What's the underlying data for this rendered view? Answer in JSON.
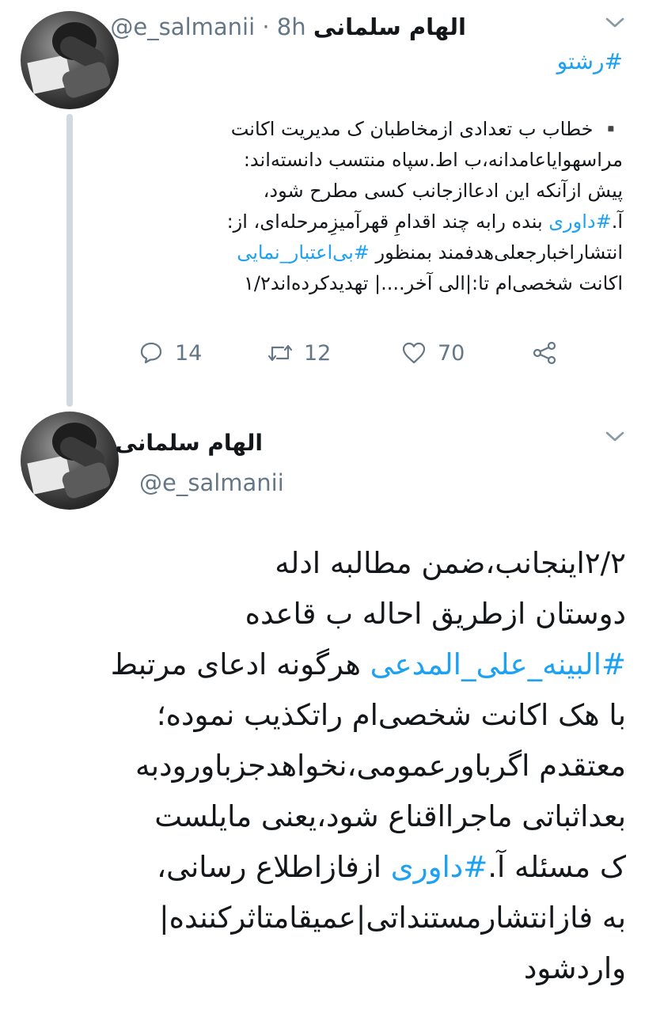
{
  "tweet1": {
    "author_name": "الهام سلمانی",
    "handle": "@e_salmanii",
    "separator": "·",
    "time": "8h",
    "thread_tag": "#رشتو",
    "lines": [
      "▪️ خطاب ب تعدادی ازمخاطبان ک مدیریت اکانت",
      "مراسهوایاعامدانه،ب اط.سپاه منتسب دانسته‌اند:",
      "پیش ازآنکه این ادعاازجانب کسی مطرح شود،"
    ],
    "line4_pre": "آ.",
    "line4_tag": "#داوری",
    "line4_post": " بنده رابه چند اقدامِ قهرآمیزِمرحله‌ای، از:",
    "line5_pre": "انتشاراخبارجعلی‌هدفمند بمنظور ",
    "line5_tag": "#بی‌اعتبار_نمایی",
    "line6": "اکانت شخصی‌ام تا:|الی آخر....| تهدیدکرده‌اند۱/۲",
    "replies": "14",
    "retweets": "12",
    "likes": "70"
  },
  "tweet2": {
    "author_name": "الهام سلمانی",
    "handle": "@e_salmanii",
    "line1": "۲/۲اینجانب،ضمن مطالبه ادله",
    "line2": "دوستان ازطریق احاله ب قاعده",
    "line3_tag": "#البینه_علی_المدعی",
    "line3_post": " هرگونه ادعای مرتبط",
    "line4": "با هک اکانت شخصی‌ام راتکذیب نموده؛",
    "line5": "معتقدم اگرباورعمومی،نخواهدجزباورودبه",
    "line6": "بعداثباتی ماجرااقناع شود،یعنی مایلست",
    "line7_pre": "ک مسئله آ.",
    "line7_tag": "#داوری",
    "line7_post": " ازفازاطلاع رسانی،",
    "line8": "به فازانتشارمستنداتی|عمیقامتاثرکننده|",
    "line9": "واردشود"
  },
  "icons": {
    "reply": "reply-icon",
    "retweet": "retweet-icon",
    "like": "heart-icon",
    "share": "share-icon",
    "menu": "chevron-down-icon"
  },
  "colors": {
    "accent": "#1da1f2",
    "muted": "#657786",
    "thread_line": "#cfd9de"
  }
}
